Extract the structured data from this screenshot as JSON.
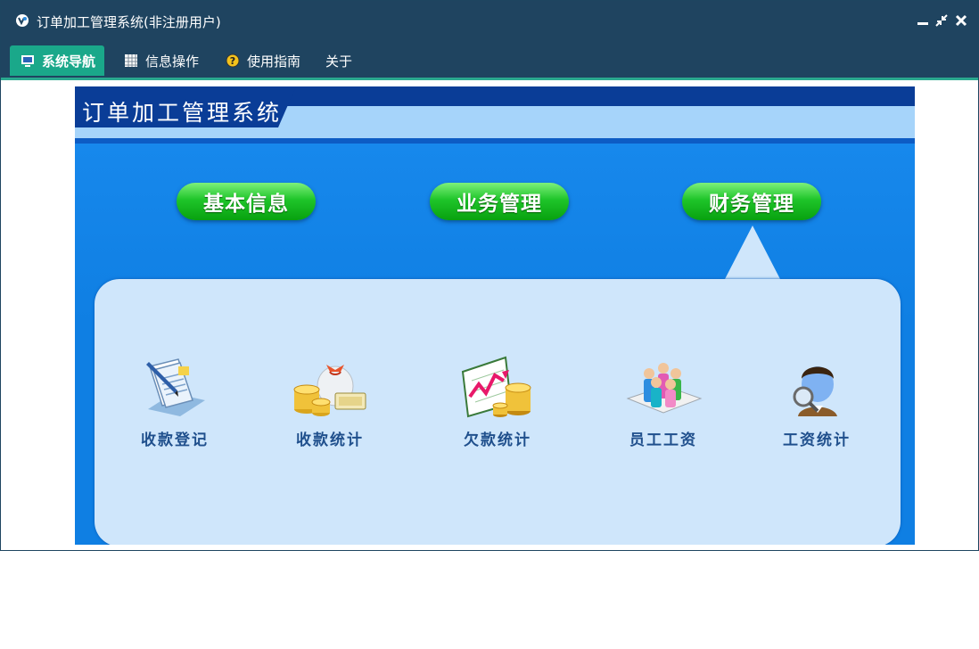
{
  "window": {
    "title": "订单加工管理系统(非注册用户)"
  },
  "menu": {
    "tabs": [
      {
        "label": "系统导航",
        "icon": "monitor-icon",
        "active": true
      },
      {
        "label": "信息操作",
        "icon": "grid-icon",
        "active": false
      },
      {
        "label": "使用指南",
        "icon": "help-icon",
        "active": false
      },
      {
        "label": "关于",
        "icon": "",
        "active": false
      }
    ]
  },
  "banner": {
    "title": "订单加工管理系统"
  },
  "modules": [
    {
      "label": "基本信息"
    },
    {
      "label": "业务管理"
    },
    {
      "label": "财务管理",
      "selected": true
    }
  ],
  "features": [
    {
      "label": "收款登记",
      "icon": "document-pen-icon"
    },
    {
      "label": "收款统计",
      "icon": "money-bag-icon"
    },
    {
      "label": "欠款统计",
      "icon": "chart-coins-icon"
    },
    {
      "label": "员工工资",
      "icon": "people-icon"
    },
    {
      "label": "工资统计",
      "icon": "person-magnifier-icon"
    }
  ],
  "colors": {
    "titlebar": "#1f4460",
    "accent": "#1aa88a",
    "content_bg": "#0f7fe3",
    "panel": "#cfe6fb",
    "pill": "#1fc52a",
    "feature_text": "#1f4f8c"
  }
}
